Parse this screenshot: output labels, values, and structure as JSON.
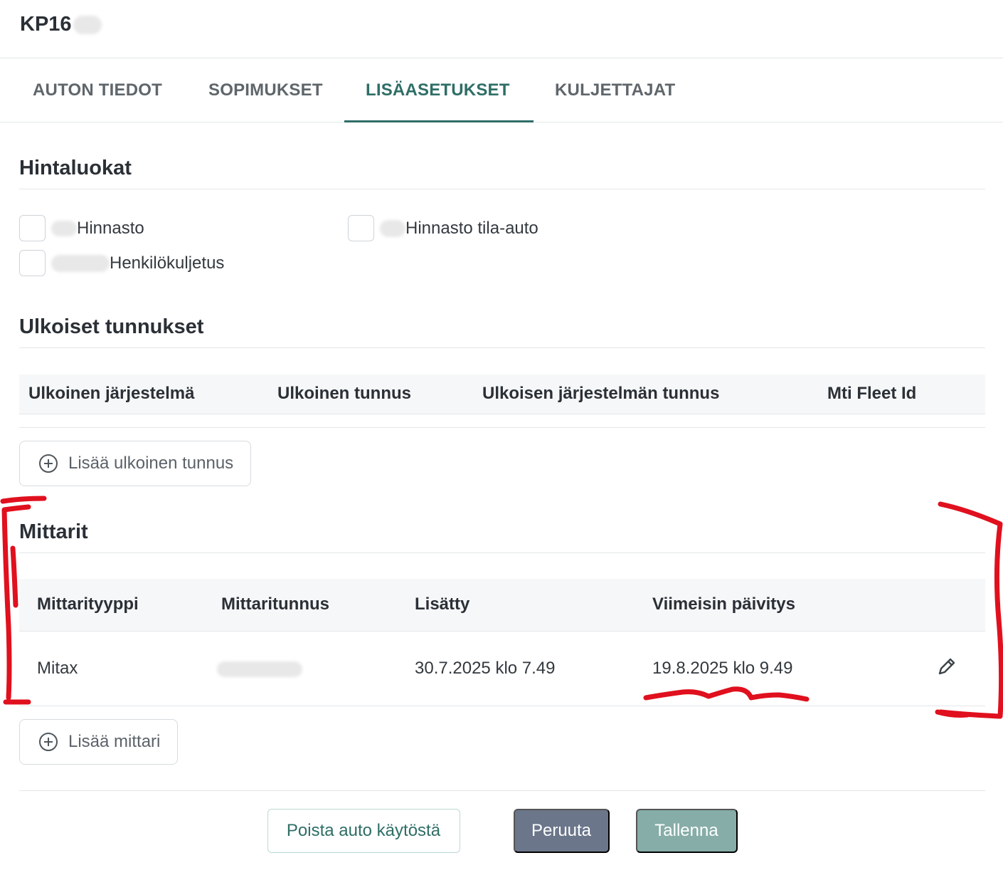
{
  "header": {
    "title": "KP16"
  },
  "tabs": [
    {
      "label": "AUTON TIEDOT",
      "active": false
    },
    {
      "label": "SOPIMUKSET",
      "active": false
    },
    {
      "label": "LISÄASETUKSET",
      "active": true
    },
    {
      "label": "KULJETTAJAT",
      "active": false
    }
  ],
  "price_classes": {
    "title": "Hintaluokat",
    "items": [
      {
        "label": "Hinnasto",
        "checked": false
      },
      {
        "label": "Hinnasto tila-auto",
        "checked": false
      },
      {
        "label": "Henkilökuljetus",
        "checked": false
      }
    ]
  },
  "external_ids": {
    "title": "Ulkoiset tunnukset",
    "columns": [
      "Ulkoinen järjestelmä",
      "Ulkoinen tunnus",
      "Ulkoisen järjestelmän tunnus",
      "Mti Fleet Id"
    ],
    "rows": [],
    "add_label": "Lisää ulkoinen tunnus"
  },
  "meters": {
    "title": "Mittarit",
    "columns": [
      "Mittarityyppi",
      "Mittaritunnus",
      "Lisätty",
      "Viimeisin päivitys"
    ],
    "rows": [
      {
        "type": "Mitax",
        "id": "",
        "added": "30.7.2025 klo 7.49",
        "updated": "19.8.2025 klo 9.49"
      }
    ],
    "add_label": "Lisää mittari"
  },
  "footer": {
    "disable_label": "Poista auto käytöstä",
    "cancel_label": "Peruuta",
    "save_label": "Tallenna"
  },
  "colors": {
    "accent": "#2e6e66",
    "cancel_bg": "#6b768a",
    "save_bg": "#86ada8",
    "annotation": "#e0101e"
  },
  "icons": [
    "plus-circle-icon",
    "pencil-icon"
  ]
}
